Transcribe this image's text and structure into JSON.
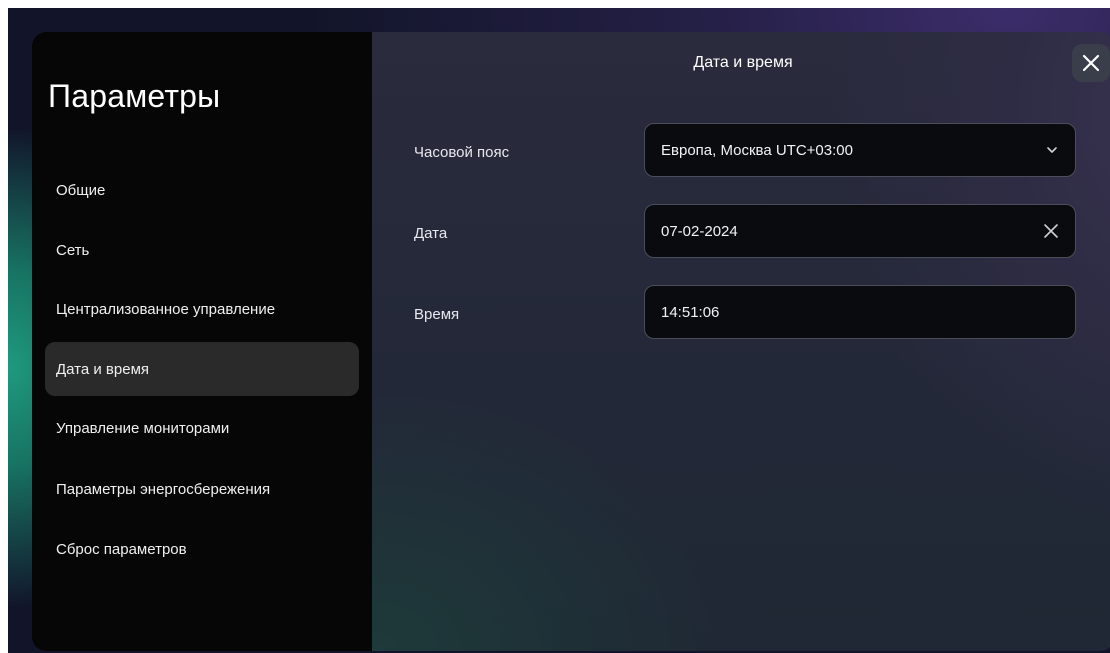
{
  "sidebar": {
    "title": "Параметры",
    "items": [
      {
        "label": "Общие",
        "active": false
      },
      {
        "label": "Сеть",
        "active": false
      },
      {
        "label": "Централизованное управление",
        "active": false
      },
      {
        "label": "Дата и время",
        "active": true
      },
      {
        "label": "Управление мониторами",
        "active": false
      },
      {
        "label": "Параметры энергосбережения",
        "active": false
      },
      {
        "label": "Сброс параметров",
        "active": false
      }
    ]
  },
  "content": {
    "title": "Дата и время",
    "timezone": {
      "label": "Часовой пояс",
      "value": "Европа, Москва UTC+03:00",
      "icon": "chevron-down-icon"
    },
    "date": {
      "label": "Дата",
      "value": "07-02-2024",
      "icon": "clear-icon"
    },
    "time": {
      "label": "Время",
      "value": "14:51:06"
    }
  },
  "colors": {
    "sidebar_bg": "#060606",
    "active_item_bg": "#2a2a2a",
    "field_bg": "#0a0b0f",
    "field_border": "#4a4d5a"
  }
}
